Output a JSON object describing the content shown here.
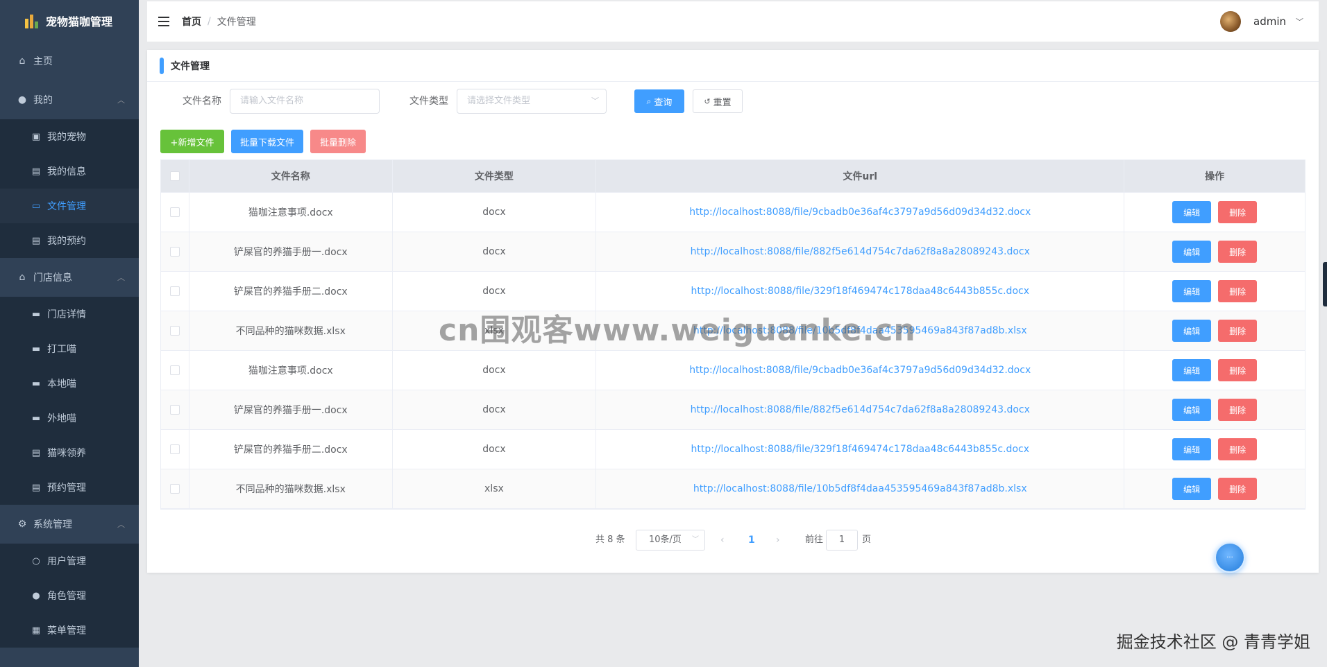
{
  "app": {
    "title": "宠物猫咖管理"
  },
  "sidebar": {
    "home": "主页",
    "groups": [
      {
        "label": "我的",
        "items": [
          "我的宠物",
          "我的信息",
          "文件管理",
          "我的预约"
        ]
      },
      {
        "label": "门店信息",
        "items": [
          "门店详情",
          "打工喵",
          "本地喵",
          "外地喵",
          "猫咪领养",
          "预约管理"
        ]
      },
      {
        "label": "系统管理",
        "items": [
          "用户管理",
          "角色管理",
          "菜单管理"
        ]
      }
    ]
  },
  "header": {
    "breadcrumb_home": "首页",
    "breadcrumb_sep": "/",
    "breadcrumb_current": "文件管理",
    "username": "admin"
  },
  "card": {
    "title": "文件管理"
  },
  "search": {
    "name_label": "文件名称",
    "name_placeholder": "请输入文件名称",
    "type_label": "文件类型",
    "type_placeholder": "请选择文件类型",
    "query_button": "查询",
    "reset_button": "重置"
  },
  "toolbar": {
    "add_button": "+新增文件",
    "download_button": "批量下载文件",
    "delete_button": "批量删除"
  },
  "table": {
    "columns": [
      "文件名称",
      "文件类型",
      "文件url",
      "操作"
    ],
    "rows": [
      {
        "name": "猫咖注意事项.docx",
        "type": "docx",
        "url": "http://localhost:8088/file/9cbadb0e36af4c3797a9d56d09d34d32.docx"
      },
      {
        "name": "铲屎官的养猫手册一.docx",
        "type": "docx",
        "url": "http://localhost:8088/file/882f5e614d754c7da62f8a8a28089243.docx"
      },
      {
        "name": "铲屎官的养猫手册二.docx",
        "type": "docx",
        "url": "http://localhost:8088/file/329f18f469474c178daa48c6443b855c.docx"
      },
      {
        "name": "不同品种的猫咪数据.xlsx",
        "type": "xlsx",
        "url": "http://localhost:8088/file/10b5df8f4daa453595469a843f87ad8b.xlsx"
      },
      {
        "name": "猫咖注意事项.docx",
        "type": "docx",
        "url": "http://localhost:8088/file/9cbadb0e36af4c3797a9d56d09d34d32.docx"
      },
      {
        "name": "铲屎官的养猫手册一.docx",
        "type": "docx",
        "url": "http://localhost:8088/file/882f5e614d754c7da62f8a8a28089243.docx"
      },
      {
        "name": "铲屎官的养猫手册二.docx",
        "type": "docx",
        "url": "http://localhost:8088/file/329f18f469474c178daa48c6443b855c.docx"
      },
      {
        "name": "不同品种的猫咪数据.xlsx",
        "type": "xlsx",
        "url": "http://localhost:8088/file/10b5df8f4daa453595469a843f87ad8b.xlsx"
      }
    ],
    "edit_label": "编辑",
    "delete_label": "删除"
  },
  "pagination": {
    "total": "共 8 条",
    "page_size": "10条/页",
    "current_page": "1",
    "goto_label": "前往",
    "goto_value": "1",
    "page_suffix": "页"
  },
  "watermarks": {
    "center": "cn围观客www.weiguanke.cn",
    "footer": "掘金技术社区 @ 青青学姐"
  },
  "colors": {
    "primary": "#409eff",
    "success": "#67c23a",
    "danger": "#f56c6c",
    "sidebar": "#304156"
  }
}
